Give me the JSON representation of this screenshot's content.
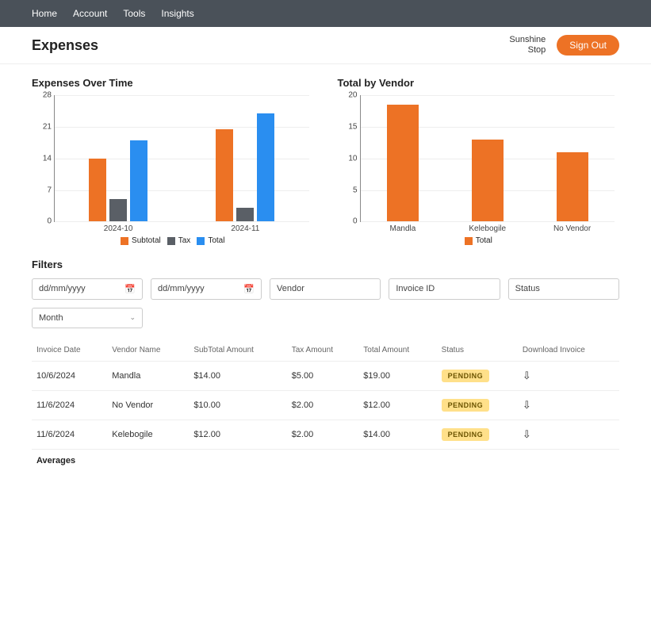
{
  "nav": {
    "items": [
      "Home",
      "Account",
      "Tools",
      "Insights"
    ]
  },
  "header": {
    "title": "Expenses",
    "user_line1": "Sunshine",
    "user_line2": "Stop",
    "signout": "Sign Out"
  },
  "chart_data": [
    {
      "type": "bar",
      "title": "Expenses Over Time",
      "categories": [
        "2024-10",
        "2024-11"
      ],
      "series": [
        {
          "name": "Subtotal",
          "values": [
            14,
            20.5
          ],
          "color": "#ed7225"
        },
        {
          "name": "Tax",
          "values": [
            5,
            3
          ],
          "color": "#5a5f66"
        },
        {
          "name": "Total",
          "values": [
            18,
            24
          ],
          "color": "#2a8ef0"
        }
      ],
      "ylim": [
        0,
        28
      ],
      "yticks": [
        0,
        7,
        14,
        21,
        28
      ]
    },
    {
      "type": "bar",
      "title": "Total by Vendor",
      "categories": [
        "Mandla",
        "Kelebogile",
        "No Vendor"
      ],
      "series": [
        {
          "name": "Total",
          "values": [
            18.5,
            13,
            11
          ],
          "color": "#ed7225"
        }
      ],
      "ylim": [
        0,
        20
      ],
      "yticks": [
        0,
        5,
        10,
        15,
        20
      ]
    }
  ],
  "filters": {
    "title": "Filters",
    "date_from": "dd/mm/yyyy",
    "date_to": "dd/mm/yyyy",
    "vendor": "Vendor",
    "invoice_id": "Invoice ID",
    "status": "Status",
    "group_by": "Month"
  },
  "table": {
    "headers": [
      "Invoice Date",
      "Vendor Name",
      "SubTotal Amount",
      "Tax Amount",
      "Total Amount",
      "Status",
      "Download Invoice"
    ],
    "rows": [
      {
        "date": "10/6/2024",
        "vendor": "Mandla",
        "subtotal": "$14.00",
        "tax": "$5.00",
        "total": "$19.00",
        "status": "PENDING"
      },
      {
        "date": "11/6/2024",
        "vendor": "No Vendor",
        "subtotal": "$10.00",
        "tax": "$2.00",
        "total": "$12.00",
        "status": "PENDING"
      },
      {
        "date": "11/6/2024",
        "vendor": "Kelebogile",
        "subtotal": "$12.00",
        "tax": "$2.00",
        "total": "$14.00",
        "status": "PENDING"
      }
    ],
    "averages_label": "Averages"
  },
  "colors": {
    "orange": "#ed7225",
    "gray": "#5a5f66",
    "blue": "#2a8ef0",
    "badge": "#ffe08a"
  }
}
